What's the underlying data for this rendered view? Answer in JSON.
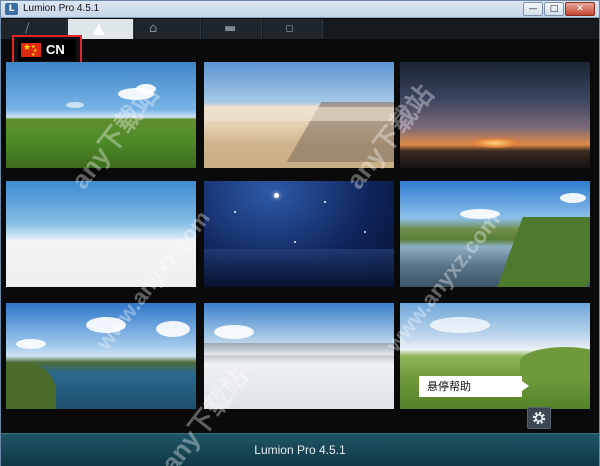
{
  "window": {
    "title": "Lumion Pro 4.5.1",
    "controls": {
      "minimize": "—",
      "maximize": "□",
      "close": "✕"
    }
  },
  "language": {
    "label": "CN",
    "flag_icon": "china-flag-icon"
  },
  "scenes": [
    {
      "id": "grassland"
    },
    {
      "id": "desert"
    },
    {
      "id": "sunset"
    },
    {
      "id": "white-plane"
    },
    {
      "id": "night"
    },
    {
      "id": "river-valley"
    },
    {
      "id": "lake-clouds"
    },
    {
      "id": "snow-mountain"
    },
    {
      "id": "green-hills"
    }
  ],
  "tooltip": {
    "text": "悬停帮助"
  },
  "settings": {
    "icon": "gear-icon"
  },
  "footer": {
    "title": "Lumion Pro 4.5.1"
  },
  "watermark": {
    "lines": [
      "any下载站",
      "www.anyxz.com"
    ]
  },
  "colors": {
    "accent_red": "#e0242b",
    "footer_bg": "#1f5566"
  }
}
